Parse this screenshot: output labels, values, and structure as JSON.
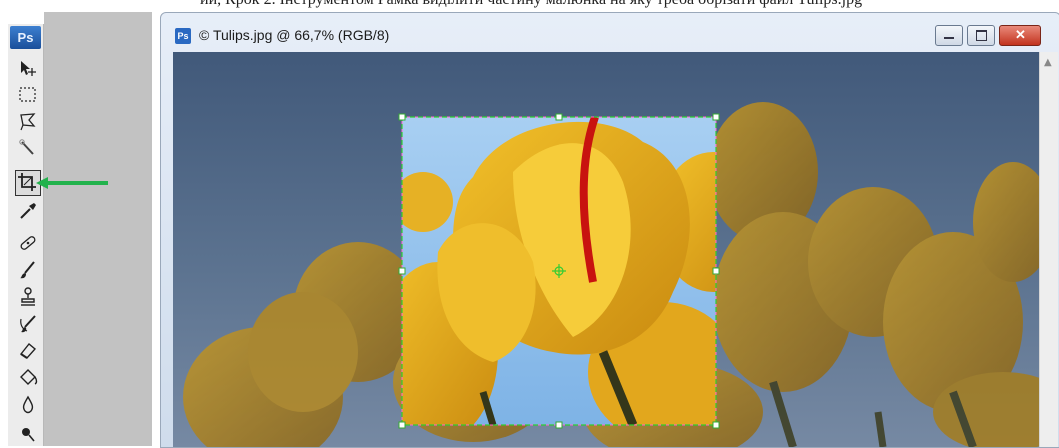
{
  "document": {
    "title": "© Tulips.jpg @ 66,7% (RGB/8)",
    "icon": "ps-document-icon",
    "window_buttons": [
      "minimize",
      "maximize",
      "close"
    ]
  },
  "app": {
    "logo_text": "Ps"
  },
  "toolbox": {
    "tools": [
      {
        "name": "move-tool",
        "icon": "move-icon"
      },
      {
        "name": "marquee-tool",
        "icon": "rect-marquee-icon"
      },
      {
        "name": "lasso-tool",
        "icon": "lasso-icon"
      },
      {
        "name": "quick-selection-tool",
        "icon": "magic-wand-icon"
      },
      {
        "name": "crop-tool",
        "icon": "crop-icon",
        "active": true
      },
      {
        "name": "eyedropper-tool",
        "icon": "eyedropper-icon"
      },
      {
        "name": "healing-brush-tool",
        "icon": "bandage-icon"
      },
      {
        "name": "brush-tool",
        "icon": "brush-icon"
      },
      {
        "name": "clone-stamp-tool",
        "icon": "stamp-icon"
      },
      {
        "name": "history-brush-tool",
        "icon": "history-brush-icon"
      },
      {
        "name": "eraser-tool",
        "icon": "eraser-icon"
      },
      {
        "name": "paint-bucket-tool",
        "icon": "bucket-icon"
      },
      {
        "name": "blur-tool",
        "icon": "drop-icon"
      },
      {
        "name": "dodge-tool",
        "icon": "dodge-icon"
      }
    ]
  },
  "annotation": {
    "arrow_color": "#22b24c",
    "highlight_color": "#e0161b"
  },
  "crop": {
    "border_color": "#33cc33",
    "marching_color": "#ff66cc"
  },
  "top_caption": "ии, Крок 2. Інструментом Рамка виділити частину малюнка на яку треба обрізати файл Tulips.jpg"
}
